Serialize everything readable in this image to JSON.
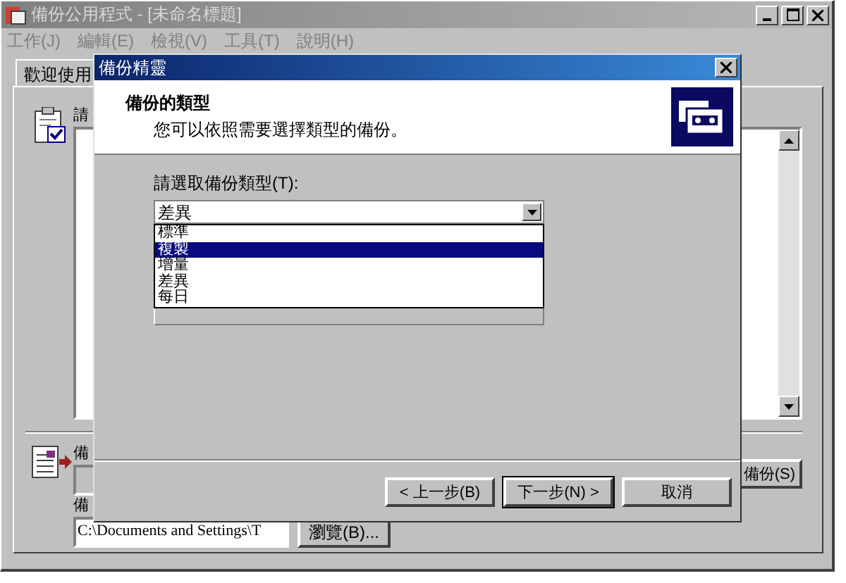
{
  "window": {
    "title": "備份公用程式 - [未命名標題]"
  },
  "menu": [
    "工作(J)",
    "編輯(E)",
    "檢視(V)",
    "工具(T)",
    "說明(H)"
  ],
  "tabs": [
    {
      "label": "歡迎使用",
      "selected": true
    }
  ],
  "main": {
    "label_1": "請",
    "label_2": "備",
    "label_3": "備",
    "path": "C:\\Documents and Settings\\T",
    "browse_button": "瀏覽(B)...",
    "backup_button": "備份(S)"
  },
  "dialog": {
    "title": "備份精靈",
    "heading": "備份的類型",
    "subtitle": "您可以依照需要選擇類型的備份。",
    "field_label": "請選取備份類型(T):",
    "combo_value": "差異",
    "options": [
      {
        "label": "標準",
        "selected": false
      },
      {
        "label": "複製",
        "selected": true
      },
      {
        "label": "增量",
        "selected": false
      },
      {
        "label": "差異",
        "selected": false
      },
      {
        "label": "每日",
        "selected": false
      }
    ],
    "buttons": [
      {
        "label": "< 上一步(B)",
        "default": false
      },
      {
        "label": "下一步(N) >",
        "default": true
      },
      {
        "label": "取消",
        "default": false
      }
    ]
  }
}
